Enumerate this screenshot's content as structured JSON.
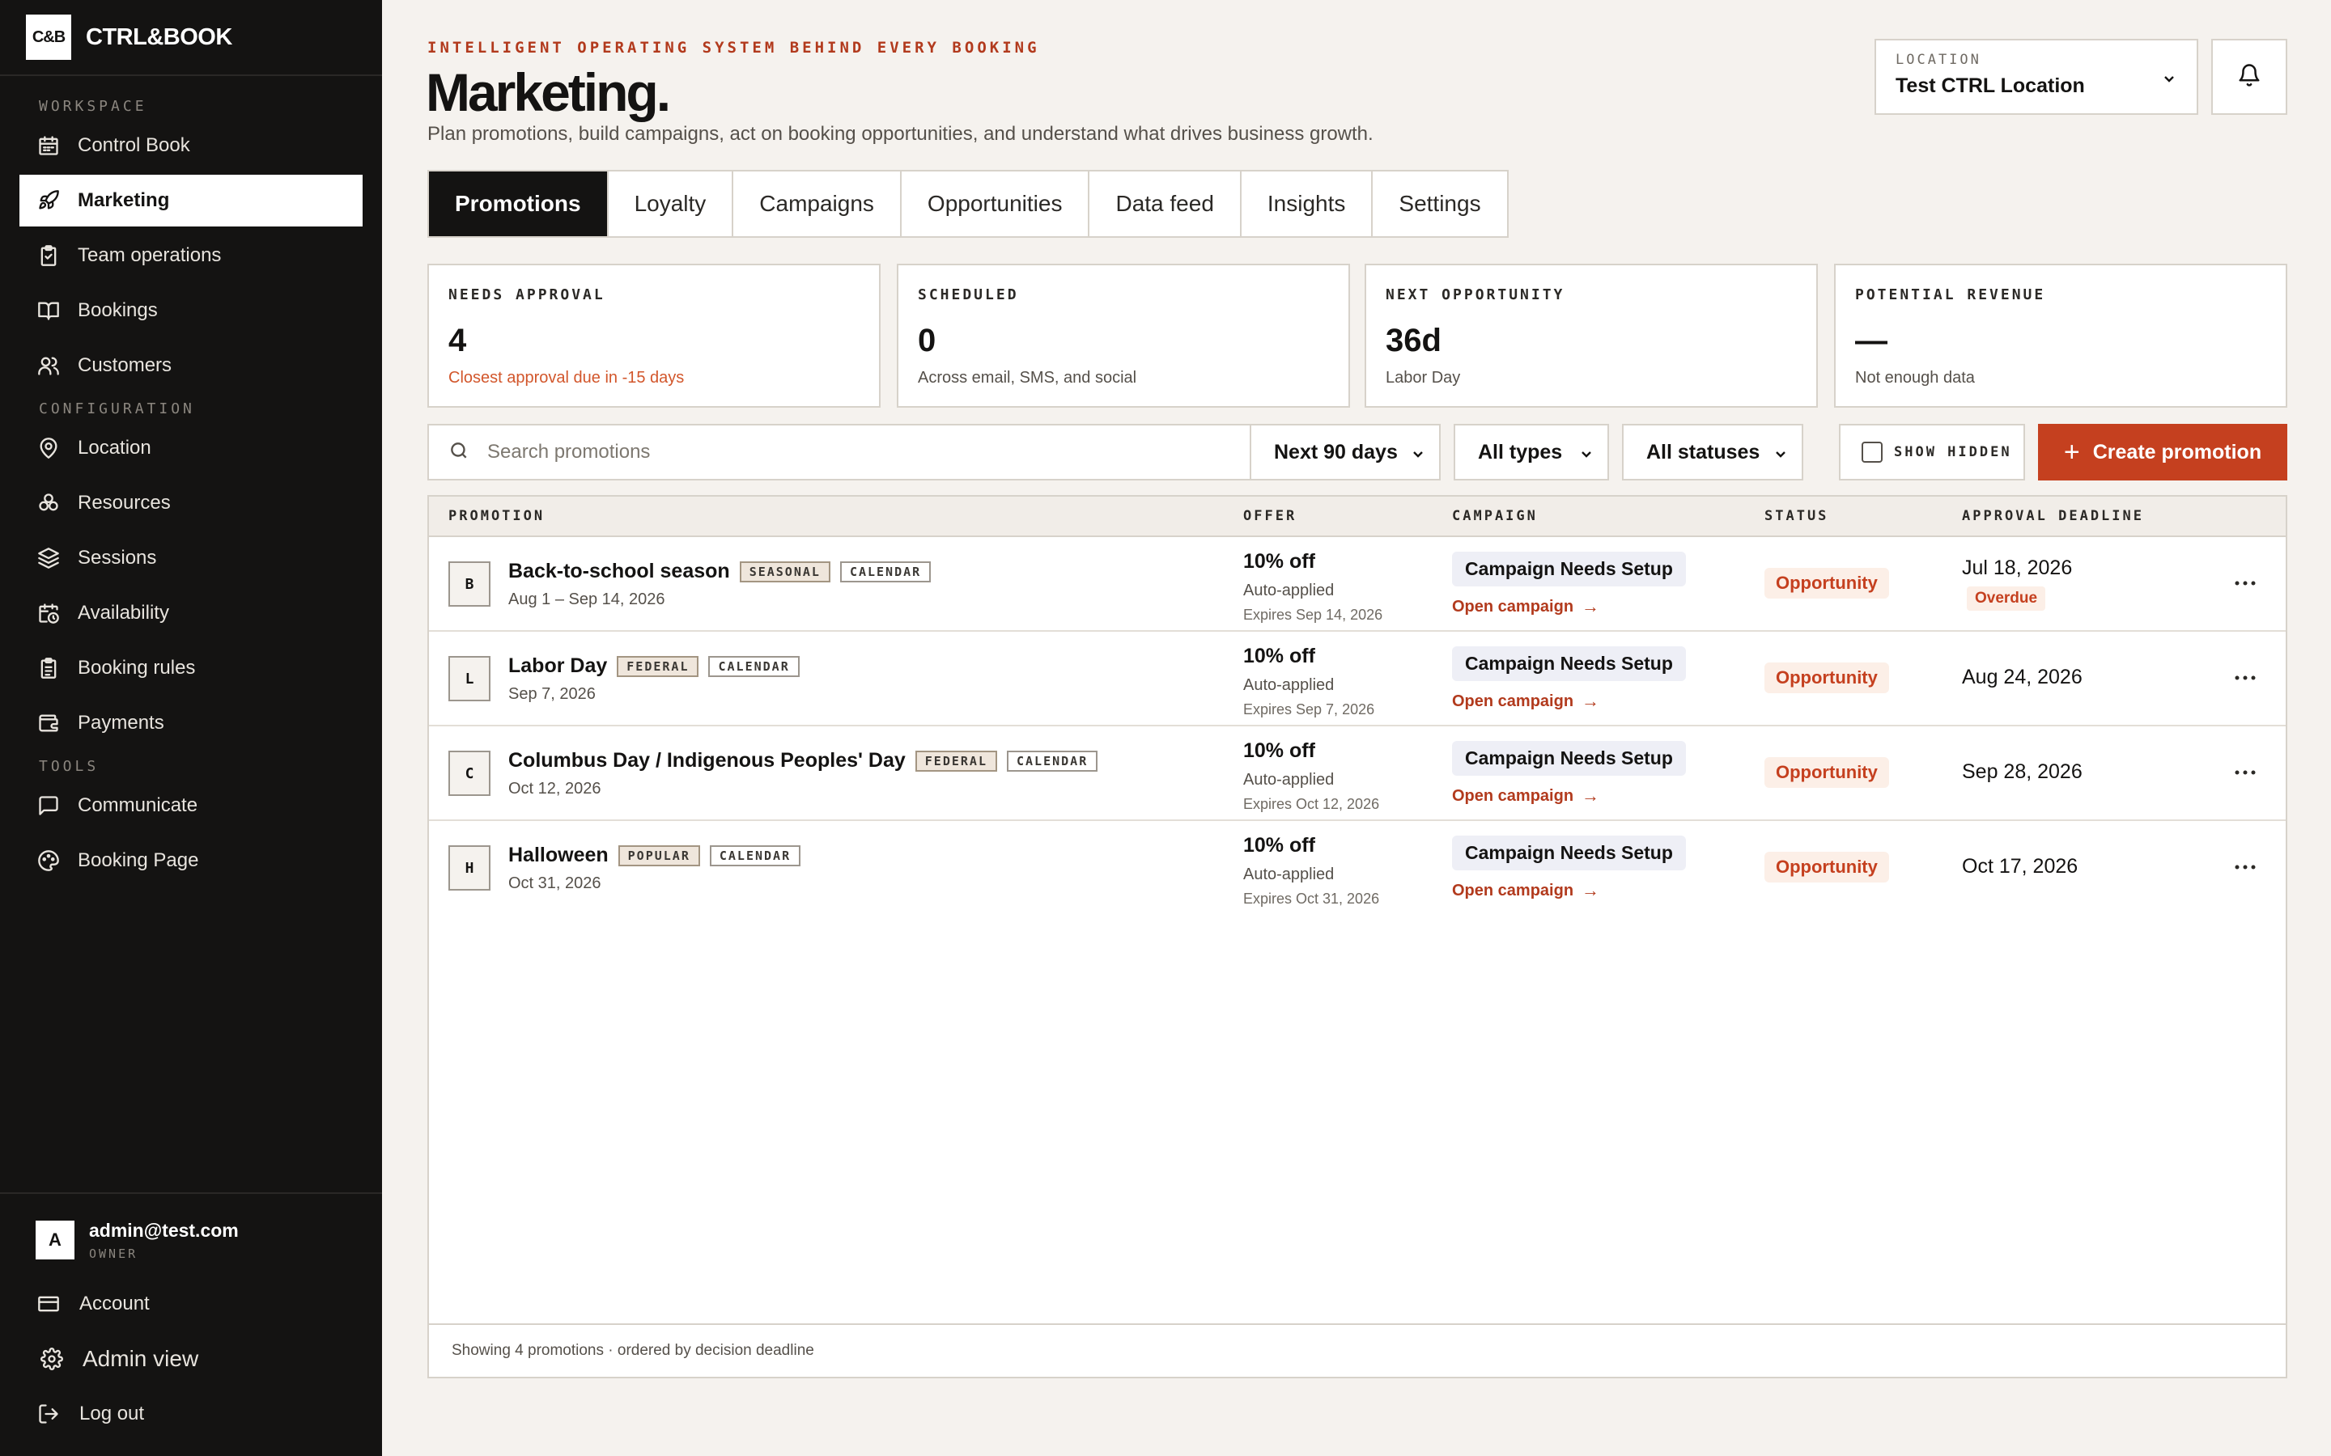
{
  "brand": {
    "logo": "C&B",
    "name": "CTRL&BOOK"
  },
  "sidebar": {
    "sections": [
      {
        "label": "WORKSPACE",
        "items": [
          {
            "label": "Control Book",
            "icon": "calendar-icon"
          },
          {
            "label": "Marketing",
            "icon": "rocket-icon",
            "active": true
          },
          {
            "label": "Team operations",
            "icon": "clipboard-icon"
          },
          {
            "label": "Bookings",
            "icon": "book-icon"
          },
          {
            "label": "Customers",
            "icon": "users-icon"
          }
        ]
      },
      {
        "label": "CONFIGURATION",
        "items": [
          {
            "label": "Location",
            "icon": "map-pin-icon"
          },
          {
            "label": "Resources",
            "icon": "boxes-icon"
          },
          {
            "label": "Sessions",
            "icon": "layers-icon"
          },
          {
            "label": "Availability",
            "icon": "calendar-clock-icon"
          },
          {
            "label": "Booking rules",
            "icon": "list-icon"
          },
          {
            "label": "Payments",
            "icon": "wallet-icon"
          }
        ]
      },
      {
        "label": "TOOLS",
        "items": [
          {
            "label": "Communicate",
            "icon": "message-icon"
          },
          {
            "label": "Booking Page",
            "icon": "palette-icon"
          }
        ]
      }
    ],
    "user": {
      "avatar": "A",
      "email": "admin@test.com",
      "role": "OWNER"
    },
    "account_label": "Account",
    "admin_label": "Admin view",
    "logout_label": "Log out"
  },
  "header": {
    "eyebrow": "INTELLIGENT OPERATING SYSTEM BEHIND EVERY BOOKING",
    "title": "Marketing.",
    "subtitle": "Plan promotions, build campaigns, act on booking opportunities, and understand what drives business growth.",
    "location_label": "LOCATION",
    "location_value": "Test CTRL Location"
  },
  "tabs": [
    {
      "label": "Promotions",
      "active": true
    },
    {
      "label": "Loyalty"
    },
    {
      "label": "Campaigns"
    },
    {
      "label": "Opportunities"
    },
    {
      "label": "Data feed"
    },
    {
      "label": "Insights"
    },
    {
      "label": "Settings"
    }
  ],
  "stats": [
    {
      "label": "NEEDS APPROVAL",
      "value": "4",
      "sub": "Closest approval due in -15 days",
      "warn": true
    },
    {
      "label": "SCHEDULED",
      "value": "0",
      "sub": "Across email, SMS, and social"
    },
    {
      "label": "NEXT OPPORTUNITY",
      "value": "36d",
      "sub": "Labor Day"
    },
    {
      "label": "POTENTIAL REVENUE",
      "value": "—",
      "sub": "Not enough data"
    }
  ],
  "toolbar": {
    "search_placeholder": "Search promotions",
    "range": "Next 90 days",
    "types": "All types",
    "statuses": "All statuses",
    "show_hidden": "SHOW HIDDEN",
    "create_label": "Create promotion"
  },
  "table": {
    "headers": [
      "PROMOTION",
      "OFFER",
      "CAMPAIGN",
      "STATUS",
      "APPROVAL DEADLINE"
    ],
    "rows": [
      {
        "initial": "B",
        "name": "Back-to-school season",
        "tags": [
          "SEASONAL",
          "CALENDAR"
        ],
        "dates": "Aug 1 – Sep 14, 2026",
        "offer": "10% off",
        "offer_mode": "Auto-applied",
        "expires": "Expires Sep 14, 2026",
        "campaign": "Campaign Needs Setup",
        "campaign_link": "Open campaign",
        "status": "Opportunity",
        "deadline": "Jul 18, 2026",
        "deadline_flag": "Overdue"
      },
      {
        "initial": "L",
        "name": "Labor Day",
        "tags": [
          "FEDERAL",
          "CALENDAR"
        ],
        "dates": "Sep 7, 2026",
        "offer": "10% off",
        "offer_mode": "Auto-applied",
        "expires": "Expires Sep 7, 2026",
        "campaign": "Campaign Needs Setup",
        "campaign_link": "Open campaign",
        "status": "Opportunity",
        "deadline": "Aug 24, 2026"
      },
      {
        "initial": "C",
        "name": "Columbus Day / Indigenous Peoples' Day",
        "tags": [
          "FEDERAL",
          "CALENDAR"
        ],
        "dates": "Oct 12, 2026",
        "offer": "10% off",
        "offer_mode": "Auto-applied",
        "expires": "Expires Oct 12, 2026",
        "campaign": "Campaign Needs Setup",
        "campaign_link": "Open campaign",
        "status": "Opportunity",
        "deadline": "Sep 28, 2026"
      },
      {
        "initial": "H",
        "name": "Halloween",
        "tags": [
          "POPULAR",
          "CALENDAR"
        ],
        "dates": "Oct 31, 2026",
        "offer": "10% off",
        "offer_mode": "Auto-applied",
        "expires": "Expires Oct 31, 2026",
        "campaign": "Campaign Needs Setup",
        "campaign_link": "Open campaign",
        "status": "Opportunity",
        "deadline": "Oct 17, 2026"
      }
    ],
    "footer": "Showing 4 promotions · ordered by decision deadline"
  },
  "colors": {
    "accent": "#c5401f",
    "sidebar_bg": "#141312",
    "page_bg": "#f5f2ee"
  }
}
